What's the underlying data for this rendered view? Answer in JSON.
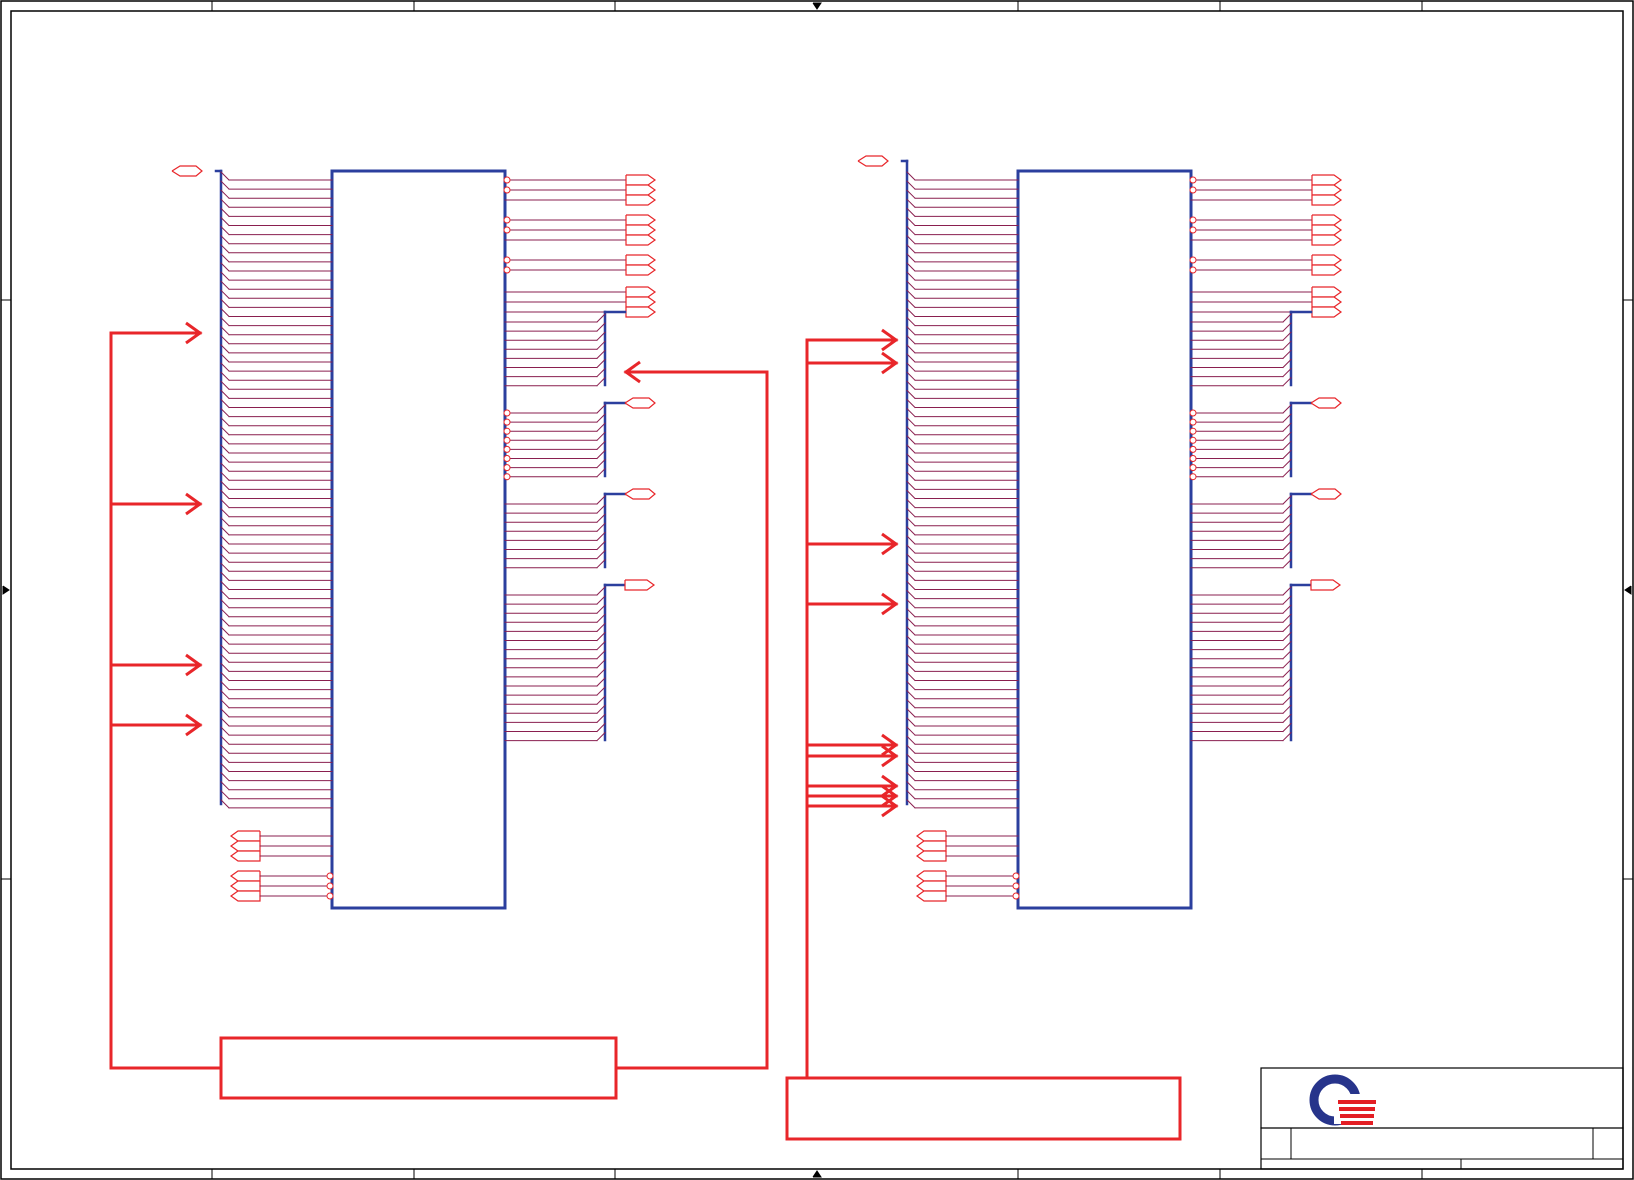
{
  "sheet": {
    "title_block": {
      "logo_name": "company-logo",
      "logo_colors": {
        "ring": "#27348b",
        "stripes": "#e31e24"
      }
    }
  },
  "colors": {
    "sheet_border": "#000000",
    "chip_outline": "#2b3f9e",
    "bus_blue": "#2b3f9e",
    "net_red": "#e8262a",
    "wire_mix": "#8a1f4f"
  },
  "icons": {
    "off_page_connector": "pentagon-flag",
    "pin_inversion": "small-circle",
    "net_arrow": "open-chevron-arrow",
    "border_marker": "small-triangle"
  }
}
